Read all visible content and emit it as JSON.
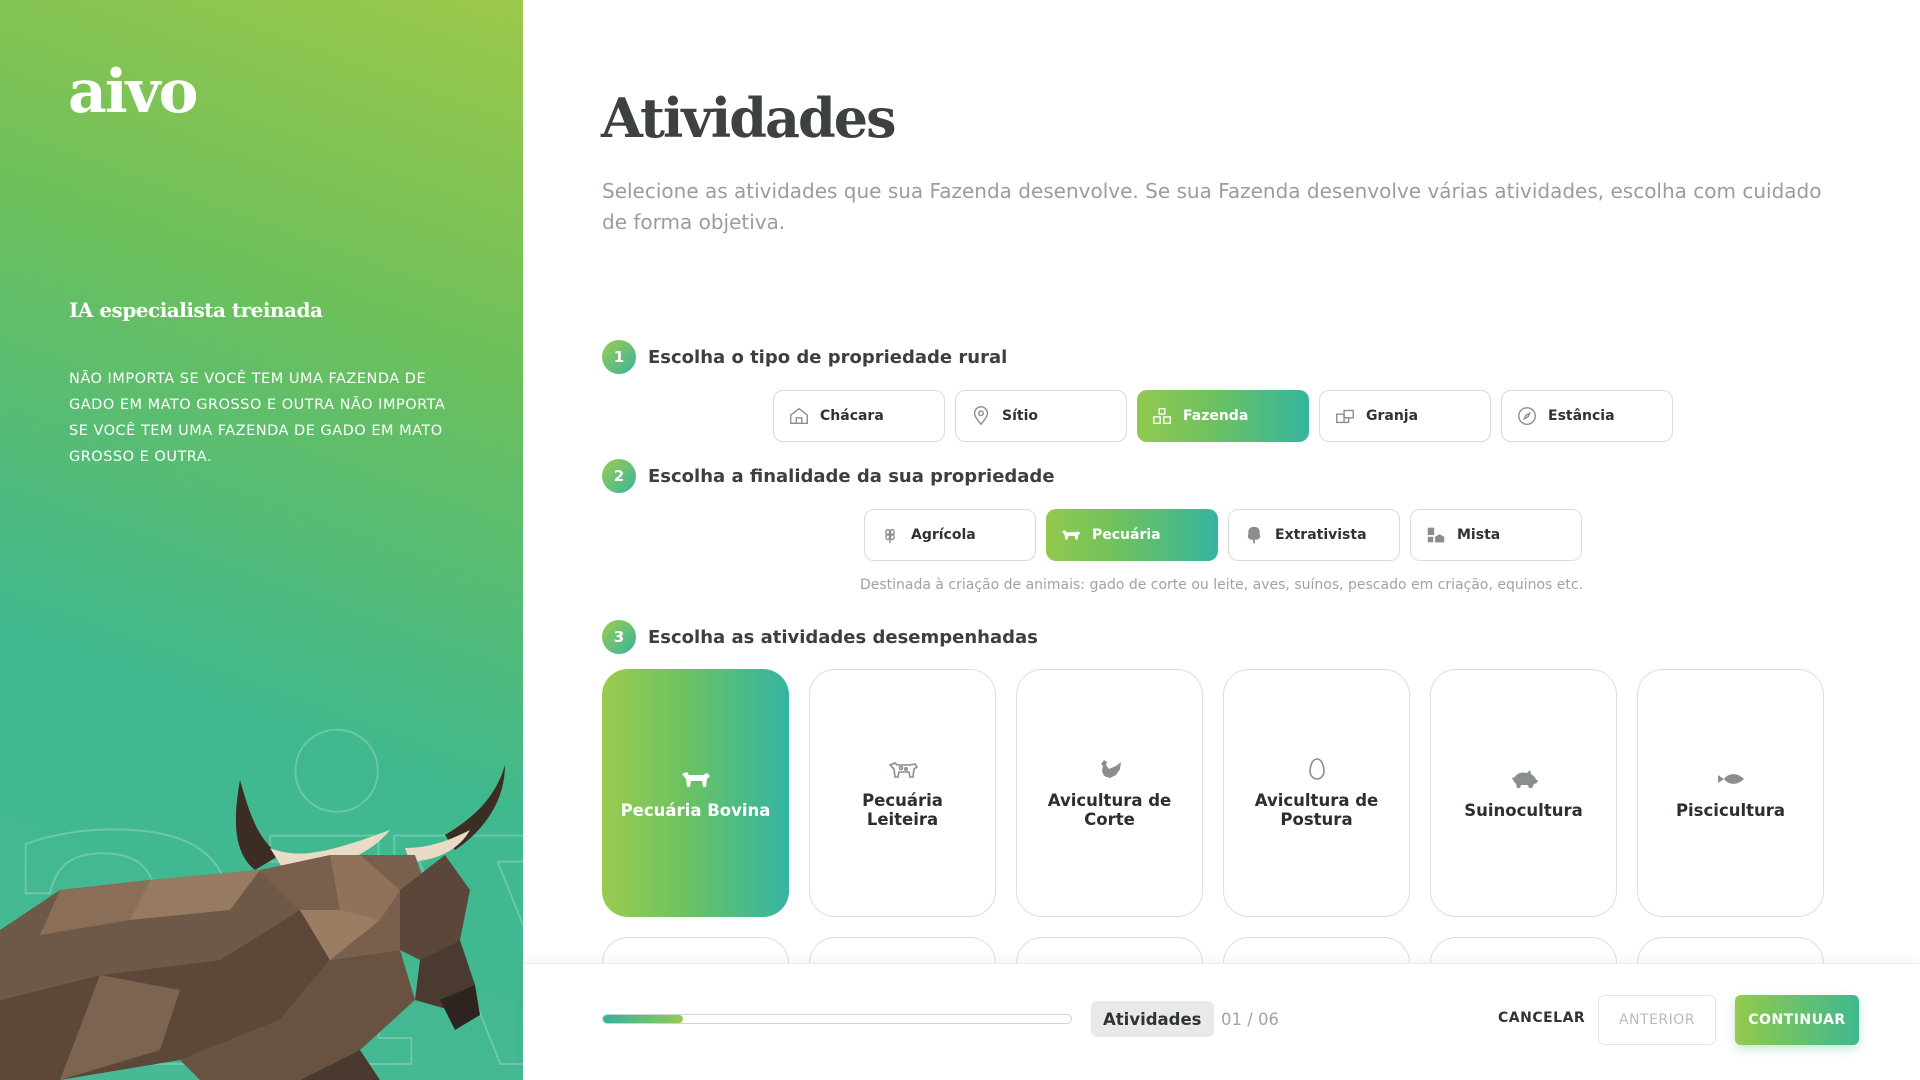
{
  "brand": {
    "logo": "aivo",
    "watermark": "aiv"
  },
  "sidebar": {
    "tagline": "IA especialista treinada",
    "description": "NÃO IMPORTA SE VOCÊ TEM UMA FAZENDA DE GADO EM MATO GROSSO E OUTRA NÃO IMPORTA SE VOCÊ TEM UMA FAZENDA DE GADO EM MATO GROSSO E OUTRA."
  },
  "main": {
    "title": "Atividades",
    "description": "Selecione as atividades que sua Fazenda desenvolve. Se sua Fazenda desenvolve várias atividades, escolha com cuidado de forma objetiva."
  },
  "steps": [
    {
      "number": "1",
      "label": "Escolha o tipo de propriedade rural",
      "options": [
        {
          "label": "Chácara",
          "icon": "house-icon",
          "selected": false
        },
        {
          "label": "Sítio",
          "icon": "location-pin-icon",
          "selected": false
        },
        {
          "label": "Fazenda",
          "icon": "farm-buildings-icon",
          "selected": true
        },
        {
          "label": "Granja",
          "icon": "barn-icon",
          "selected": false
        },
        {
          "label": "Estância",
          "icon": "compass-icon",
          "selected": false
        }
      ]
    },
    {
      "number": "2",
      "label": "Escolha a finalidade da sua propriedade",
      "options": [
        {
          "label": "Agrícola",
          "icon": "wheat-icon",
          "selected": false
        },
        {
          "label": "Pecuária",
          "icon": "cow-icon",
          "selected": true
        },
        {
          "label": "Extrativista",
          "icon": "tree-icon",
          "selected": false
        },
        {
          "label": "Mista",
          "icon": "mixed-icon",
          "selected": false
        }
      ],
      "hint": "Destinada à criação de animais: gado de corte ou leite, aves, suínos, pescado em criação, equinos etc."
    },
    {
      "number": "3",
      "label": "Escolha as atividades desempenhadas",
      "activities": [
        {
          "label": "Pecuária Bovina",
          "icon": "cow-icon",
          "selected": true
        },
        {
          "label": "Pecuária Leiteira",
          "icon": "dairy-cow-icon",
          "selected": false
        },
        {
          "label": "Avicultura de Corte",
          "icon": "rooster-icon",
          "selected": false
        },
        {
          "label": "Avicultura de Postura",
          "icon": "egg-icon",
          "selected": false
        },
        {
          "label": "Suinocultura",
          "icon": "pig-icon",
          "selected": false
        },
        {
          "label": "Piscicultura",
          "icon": "fish-icon",
          "selected": false
        }
      ]
    }
  ],
  "footer": {
    "progress": 0.17,
    "section": "Atividades",
    "step_count": "01 / 06",
    "cancel": "CANCELAR",
    "previous": "ANTERIOR",
    "next": "CONTINUAR"
  },
  "colors": {
    "accent_start": "#9acb4e",
    "accent_end": "#33b5a3",
    "title": "#3d4140"
  }
}
